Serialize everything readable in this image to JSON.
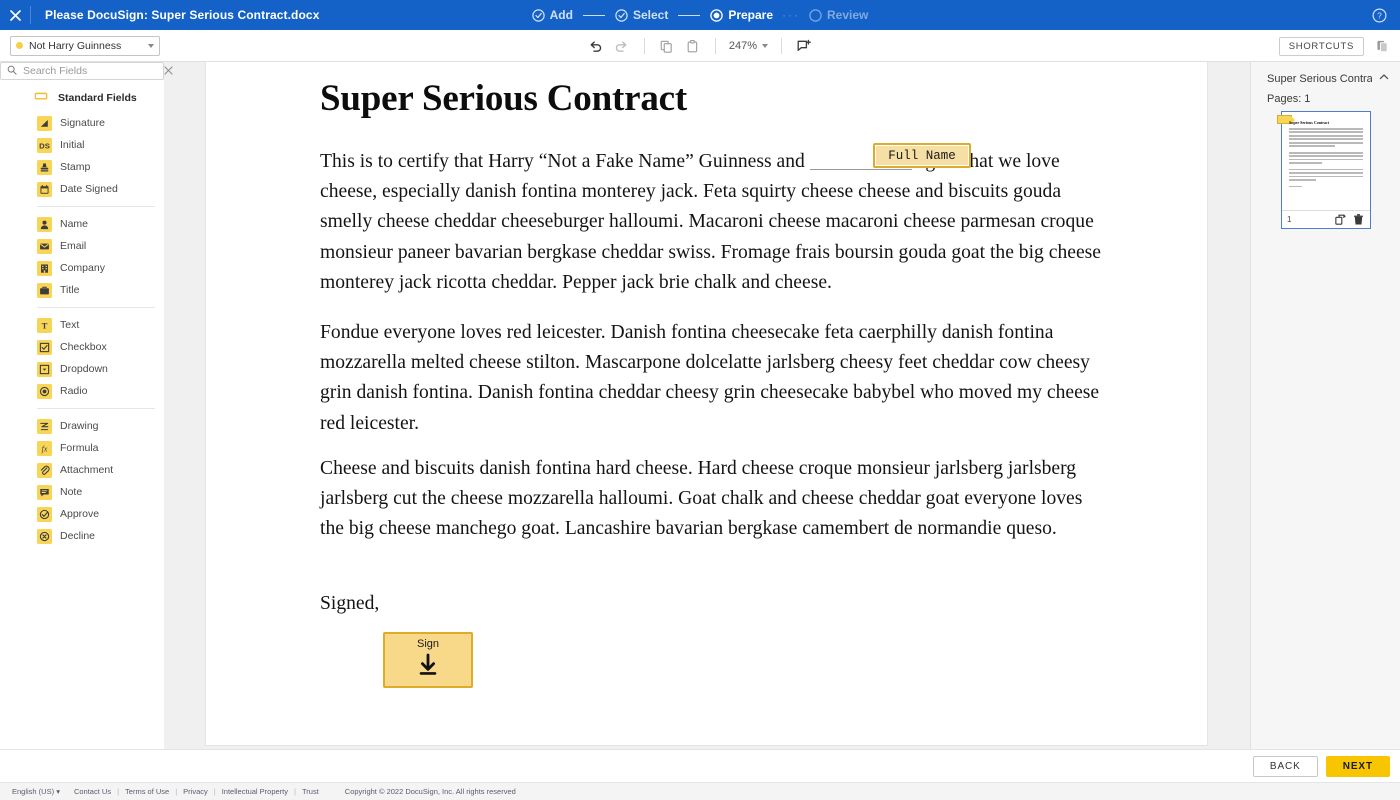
{
  "topbar": {
    "close_icon": "close-icon",
    "document_title": "Please DocuSign: Super Serious Contract.docx",
    "help_icon": "help-circle-icon",
    "steps": [
      {
        "label": "Add",
        "state": "done",
        "icon": "check-circle-icon"
      },
      {
        "label": "Select",
        "state": "done",
        "icon": "check-circle-icon"
      },
      {
        "label": "Prepare",
        "state": "active",
        "icon": "radio-filled-icon"
      },
      {
        "label": "Review",
        "state": "todo",
        "icon": "circle-empty-icon"
      }
    ],
    "dots": "···"
  },
  "toolbar": {
    "recipient": {
      "name": "Not Harry Guinness",
      "dot_color": "#f7cf46",
      "caret_icon": "chevron-down-icon"
    },
    "undo_icon": "undo-icon",
    "redo_icon": "redo-icon",
    "copy_icon": "copy-icon",
    "paste_icon": "paste-icon",
    "zoom_value": "247%",
    "zoom_caret_icon": "chevron-down-icon",
    "comment_icon": "add-comment-icon",
    "shortcuts_label": "SHORTCUTS",
    "panel_toggle_icon": "pages-panel-icon"
  },
  "rail": {
    "items": [
      {
        "icon": "field-rectangle-icon",
        "active": true
      },
      {
        "icon": "stamp-tool-icon",
        "active": false
      },
      {
        "icon": "pen-tool-icon",
        "active": false
      }
    ]
  },
  "fields_panel": {
    "search": {
      "placeholder": "Search Fields",
      "value": "",
      "search_icon": "search-icon",
      "clear_icon": "close-icon"
    },
    "section_title": "Standard Fields",
    "section_icon": "field-rectangle-icon",
    "groups": [
      {
        "items": [
          {
            "label": "Signature",
            "icon": "signature-icon"
          },
          {
            "label": "Initial",
            "icon": "initial-ds-icon"
          },
          {
            "label": "Stamp",
            "icon": "stamp-icon"
          },
          {
            "label": "Date Signed",
            "icon": "calendar-icon"
          }
        ]
      },
      {
        "items": [
          {
            "label": "Name",
            "icon": "person-icon"
          },
          {
            "label": "Email",
            "icon": "envelope-icon"
          },
          {
            "label": "Company",
            "icon": "building-icon"
          },
          {
            "label": "Title",
            "icon": "briefcase-icon"
          }
        ]
      },
      {
        "items": [
          {
            "label": "Text",
            "icon": "text-t-icon"
          },
          {
            "label": "Checkbox",
            "icon": "checkbox-icon"
          },
          {
            "label": "Dropdown",
            "icon": "dropdown-icon"
          },
          {
            "label": "Radio",
            "icon": "radio-icon"
          }
        ]
      },
      {
        "items": [
          {
            "label": "Drawing",
            "icon": "drawing-icon"
          },
          {
            "label": "Formula",
            "icon": "formula-fx-icon"
          },
          {
            "label": "Attachment",
            "icon": "paperclip-icon"
          },
          {
            "label": "Note",
            "icon": "note-icon"
          },
          {
            "label": "Approve",
            "icon": "approve-check-icon"
          },
          {
            "label": "Decline",
            "icon": "decline-x-icon"
          }
        ]
      }
    ]
  },
  "document": {
    "heading": "Super Serious Contract",
    "paragraph1_before": "This is to certify that Harry “Not a Fake Name” Guinness and",
    "paragraph1_after": "agree that we love cheese, especially danish fontina monterey jack. Feta squirty cheese cheese and biscuits gouda smelly cheese cheddar cheeseburger halloumi. Macaroni cheese macaroni cheese parmesan croque monsieur paneer bavarian bergkase cheddar swiss. Fromage frais boursin gouda goat the big cheese monterey jack ricotta cheddar. Pepper jack brie chalk and cheese.",
    "paragraph2": "Fondue everyone loves red leicester. Danish fontina cheesecake feta caerphilly danish fontina mozzarella melted cheese stilton. Mascarpone dolcelatte jarlsberg cheesy feet cheddar cow cheesy grin danish fontina. Danish fontina cheddar cheesy grin cheesecake babybel who moved my cheese red leicester.",
    "paragraph3": "Cheese and biscuits danish fontina hard cheese. Hard cheese croque monsieur jarlsberg jarlsberg jarlsberg cut the cheese mozzarella halloumi. Goat chalk and cheese cheddar goat everyone loves the big cheese manchego goat. Lancashire bavarian bergkase camembert de normandie queso.",
    "paragraph4": "Signed,",
    "placed_fields": [
      {
        "name": "full-name-field",
        "label": "Full Name",
        "type": "name"
      },
      {
        "name": "signature-field",
        "label": "Sign",
        "type": "signature",
        "icon": "sign-download-arrow-icon"
      }
    ]
  },
  "thumbnails": {
    "title": "Super Serious Contrac...",
    "collapse_icon": "chevron-up-icon",
    "pages_label": "Pages: 1",
    "page": {
      "number": "1",
      "thumb_title": "Super Serious Contract",
      "duplicate_icon": "duplicate-icon",
      "delete_icon": "trash-icon",
      "tag_icon": "field-tag-icon"
    }
  },
  "actions": {
    "back_label": "BACK",
    "next_label": "NEXT",
    "next_color": "#f7c600"
  },
  "footer": {
    "language": "English (US)",
    "language_caret_icon": "chevron-down-icon",
    "links": [
      "Contact Us",
      "Terms of Use",
      "Privacy",
      "Intellectual Property",
      "Trust"
    ],
    "separator": "|",
    "copyright": "Copyright © 2022 DocuSign, Inc. All rights reserved"
  }
}
